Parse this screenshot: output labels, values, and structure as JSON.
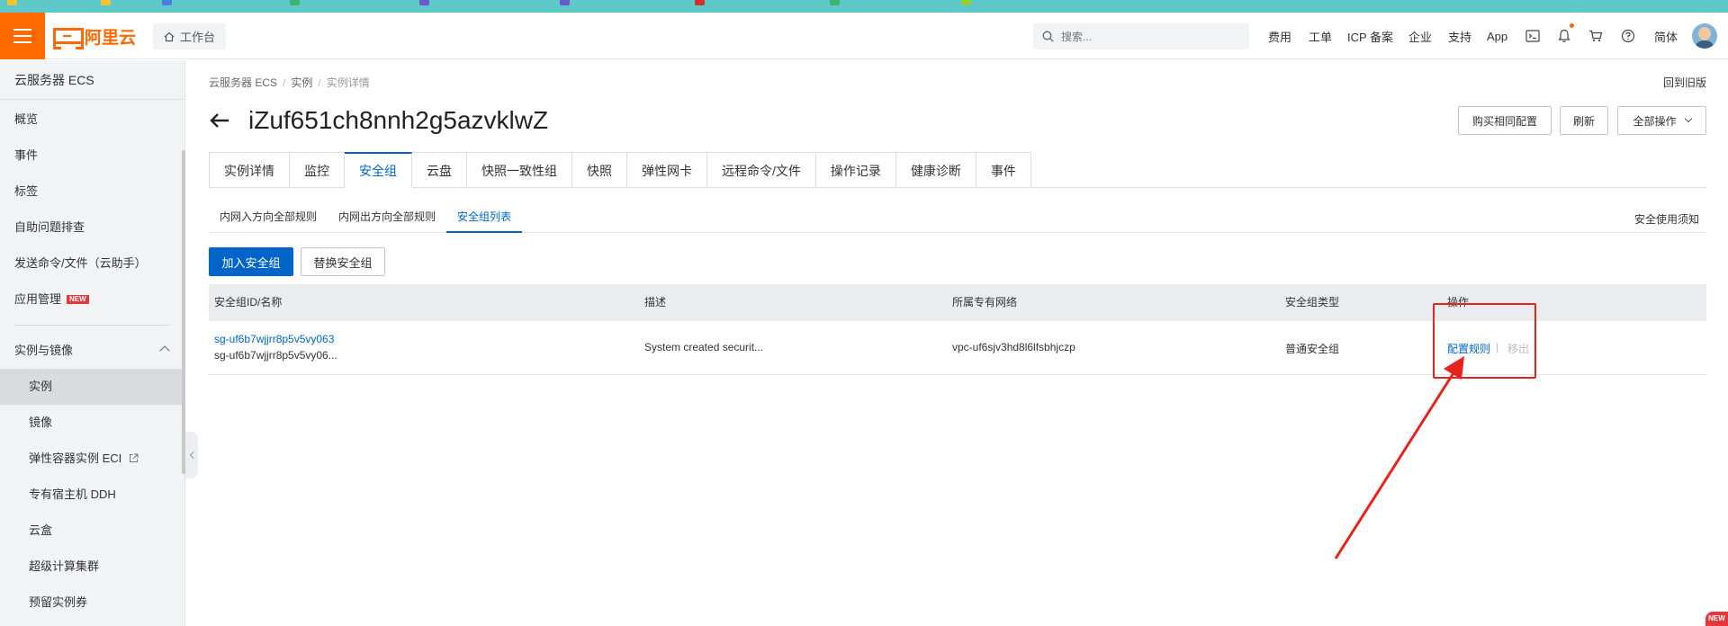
{
  "topbar": {
    "workbench_label": "工作台",
    "search_placeholder": "搜索...",
    "nav": [
      "费用",
      "工单",
      "ICP 备案",
      "企业",
      "支持",
      "App"
    ],
    "language": "简体",
    "icons": [
      "terminal-icon",
      "bell-icon",
      "cart-icon",
      "help-icon"
    ]
  },
  "logo": {
    "text": "阿里云"
  },
  "sidebar": {
    "title": "云服务器 ECS",
    "items": [
      "概览",
      "事件",
      "标签",
      "自助问题排查",
      "发送命令/文件（云助手）",
      "应用管理"
    ],
    "app_badge": "NEW",
    "group": "实例与镜像",
    "sub_items": [
      "实例",
      "镜像",
      "弹性容器实例 ECI",
      "专有宿主机 DDH",
      "云盒",
      "超级计算集群",
      "预留实例券"
    ],
    "active": "实例"
  },
  "breadcrumb": [
    "云服务器 ECS",
    "实例",
    "实例详情"
  ],
  "back_old": "回到旧版",
  "page": {
    "title": "iZuf651ch8nnh2g5azvklwZ",
    "buttons": [
      "购买相同配置",
      "刷新",
      "全部操作"
    ]
  },
  "tabs": [
    "实例详情",
    "监控",
    "安全组",
    "云盘",
    "快照一致性组",
    "快照",
    "弹性网卡",
    "远程命令/文件",
    "操作记录",
    "健康诊断",
    "事件"
  ],
  "active_tab": "安全组",
  "subtabs": [
    "内网入方向全部规则",
    "内网出方向全部规则",
    "安全组列表"
  ],
  "active_subtab": "安全组列表",
  "notice": "安全使用须知",
  "actions": {
    "join": "加入安全组",
    "replace": "替换安全组"
  },
  "table": {
    "headers": [
      "安全组ID/名称",
      "描述",
      "所属专有网络",
      "安全组类型",
      "操作"
    ],
    "rows": [
      {
        "id": "sg-uf6b7wjjrr8p5v5vy063",
        "name": "sg-uf6b7wjjrr8p5v5vy06...",
        "description": "System created securit...",
        "vpc": "vpc-uf6sjv3hd8l6lfsbhjczp",
        "type": "普通安全组",
        "op_config": "配置规则",
        "op_sep": "|",
        "op_remove": "移出"
      }
    ]
  },
  "corner_badge": "NEW",
  "colors": {
    "brand": "#ff6a00",
    "primary": "#0064c8",
    "annotation": "#e8231e"
  }
}
